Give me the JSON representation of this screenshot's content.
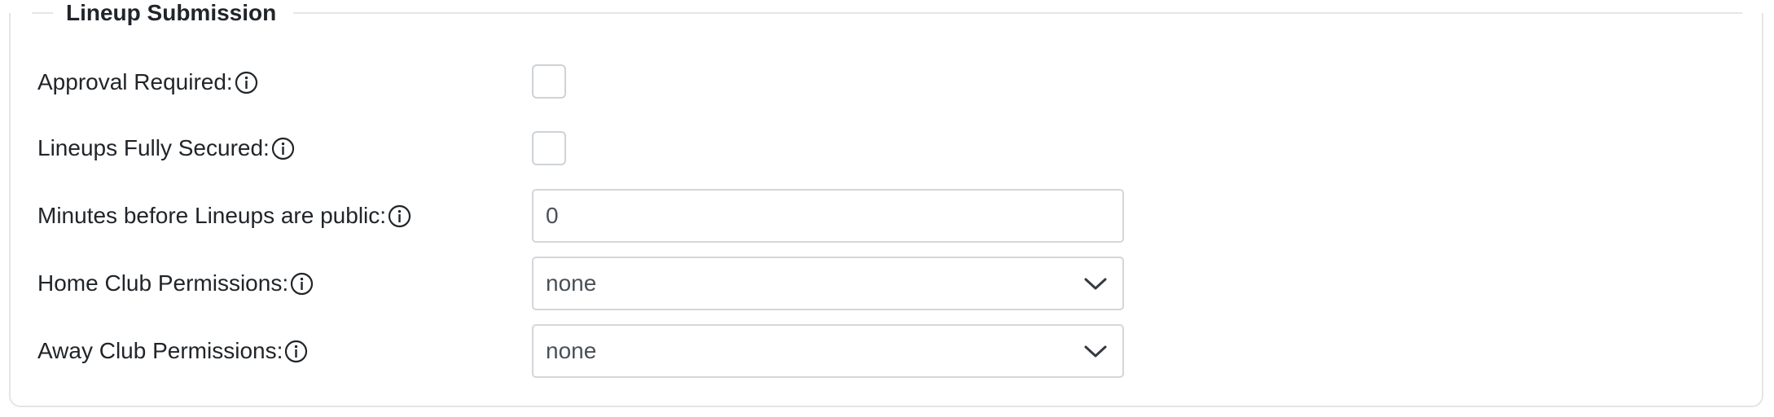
{
  "section": {
    "title": "Lineup Submission"
  },
  "fields": {
    "approval_required": {
      "label": "Approval Required:",
      "checked": false
    },
    "lineups_fully_secured": {
      "label": "Lineups Fully Secured:",
      "checked": false
    },
    "minutes_before_public": {
      "label": "Minutes before Lineups are public:",
      "value": "0"
    },
    "home_club_permissions": {
      "label": "Home Club Permissions:",
      "selected": "none"
    },
    "away_club_permissions": {
      "label": "Away Club Permissions:",
      "selected": "none"
    }
  },
  "icons": {
    "info": "info-circle-icon",
    "dropdown": "chevron-down-icon"
  },
  "colors": {
    "text": "#212529",
    "border": "#d3d6da",
    "fieldset_border": "#e3e5e8",
    "input_text": "#495057"
  }
}
